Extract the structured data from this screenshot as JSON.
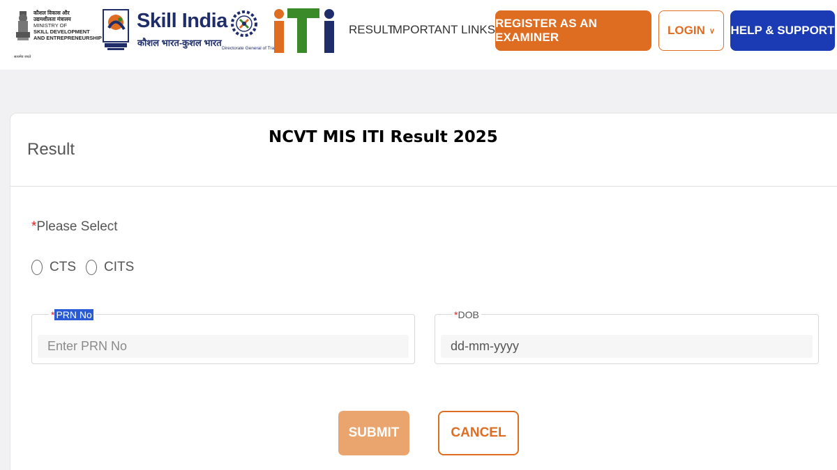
{
  "header": {
    "ministry": {
      "hindi_line1": "कौशल विकास और",
      "hindi_line2": "उद्यमशीलता मंत्रालय",
      "en_line1": "MINISTRY OF",
      "en_line2": "SKILL DEVELOPMENT",
      "en_line3": "AND ENTREPRENEURSHIP",
      "motto": "सत्यमेव जयते"
    },
    "skill_india": {
      "title": "Skill India",
      "subtitle": "कौशल भारत-कुशल भारत"
    },
    "dgt_text": "Directorate General of Training",
    "iti_logo": "iti",
    "nav": {
      "result": "RESULT",
      "important_links": "IMPORTANT LINKS"
    },
    "buttons": {
      "register": "REGISTER AS AN EXAMINER",
      "login": "LOGIN",
      "help": "HELP & SUPPORT"
    },
    "colors": {
      "orange": "#df6d21",
      "blue": "#1a3bb3",
      "navy": "#1f2d6b"
    }
  },
  "card": {
    "title": "Result",
    "overlay_title": "NCVT MIS ITI Result 2025",
    "please_select": "Please Select",
    "required_mark": "*",
    "radios": [
      {
        "label": "CTS",
        "checked": false
      },
      {
        "label": "CITS",
        "checked": false
      }
    ],
    "prn": {
      "label": "PRN No",
      "placeholder": "Enter PRN No"
    },
    "dob": {
      "label": "DOB",
      "value": "dd-mm-yyyy"
    },
    "submit": "SUBMIT",
    "cancel": "CANCEL"
  }
}
